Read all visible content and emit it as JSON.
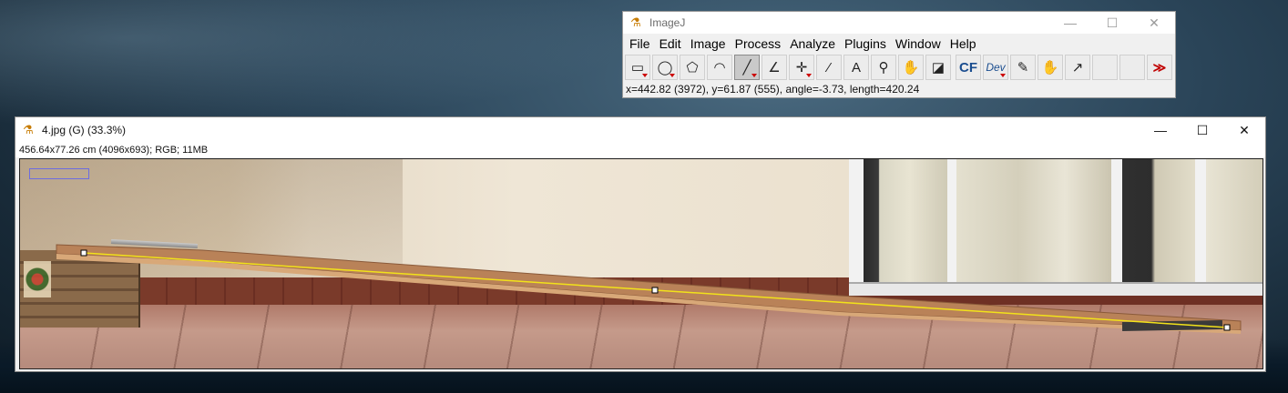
{
  "main_window": {
    "title": "ImageJ",
    "menus": [
      "File",
      "Edit",
      "Image",
      "Process",
      "Analyze",
      "Plugins",
      "Window",
      "Help"
    ],
    "tools": [
      {
        "name": "rectangle-tool-icon",
        "glyph": "▭",
        "has_menu": true
      },
      {
        "name": "oval-tool-icon",
        "glyph": "◯",
        "has_menu": true
      },
      {
        "name": "polygon-tool-icon",
        "glyph": "⬠",
        "has_menu": false
      },
      {
        "name": "freehand-tool-icon",
        "glyph": "◠",
        "has_menu": false
      },
      {
        "name": "line-tool-icon",
        "glyph": "╱",
        "has_menu": true,
        "selected": true
      },
      {
        "name": "angle-tool-icon",
        "glyph": "∠",
        "has_menu": false
      },
      {
        "name": "point-tool-icon",
        "glyph": "✛",
        "has_menu": true
      },
      {
        "name": "wand-tool-icon",
        "glyph": "⁄",
        "has_menu": false
      },
      {
        "name": "text-tool-icon",
        "glyph": "A",
        "has_menu": false
      },
      {
        "name": "zoom-tool-icon",
        "glyph": "⚲",
        "has_menu": false
      },
      {
        "name": "hand-tool-icon",
        "glyph": "✋",
        "has_menu": false
      },
      {
        "name": "dropper-tool-icon",
        "glyph": "◪",
        "has_menu": false
      },
      {
        "name": "cf-tool",
        "glyph": "CF",
        "has_menu": false,
        "style": "cf",
        "gap": true
      },
      {
        "name": "dev-tool",
        "glyph": "Dev",
        "has_menu": true,
        "style": "dev"
      },
      {
        "name": "brush-tool-icon",
        "glyph": "✎",
        "has_menu": false
      },
      {
        "name": "flood-fill-tool-icon",
        "glyph": "✋",
        "has_menu": false
      },
      {
        "name": "arrow-tool-icon",
        "glyph": "↗",
        "has_menu": false
      },
      {
        "name": "empty-tool-slot-1",
        "glyph": "",
        "has_menu": false
      },
      {
        "name": "empty-tool-slot-2",
        "glyph": "",
        "has_menu": false
      },
      {
        "name": "more-tools-icon",
        "glyph": "≫",
        "has_menu": false,
        "style": "more"
      }
    ],
    "status": "x=442.82 (3972), y=61.87 (555), angle=-3.73, length=420.24"
  },
  "image_window": {
    "title": "4.jpg (G) (33.3%)",
    "info": "456.64x77.26 cm (4096x693); RGB; 11MB"
  },
  "colors": {
    "selection_line": "#f2e21a",
    "roi_rect": "#6c6ce0",
    "red_accent": "#c00000"
  }
}
